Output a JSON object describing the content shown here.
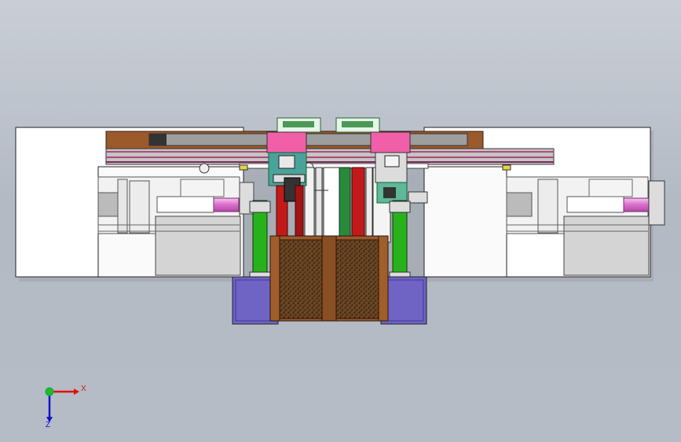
{
  "app": {
    "title": ""
  },
  "triad": {
    "x_label": "X",
    "z_label": "Z",
    "x_color": "#d11",
    "y_color": "#2b2",
    "z_color": "#11c"
  },
  "model": {
    "view": "front",
    "colors": {
      "frame_white": "#ffffff",
      "rail_brown": "#9a5a2c",
      "rail_gray": "#9c9c9c",
      "rail_stripe": "#b04a7a",
      "block_pink": "#f05fa8",
      "block_teal": "#4aa39a",
      "bar_red": "#c21a1a",
      "bar_green": "#27b21c",
      "cylinder_pink": "#e98be0",
      "base_blue": "#6f64c4",
      "feed_brown": "#5b3a1e",
      "panel_gray": "#d2d2d2"
    }
  }
}
